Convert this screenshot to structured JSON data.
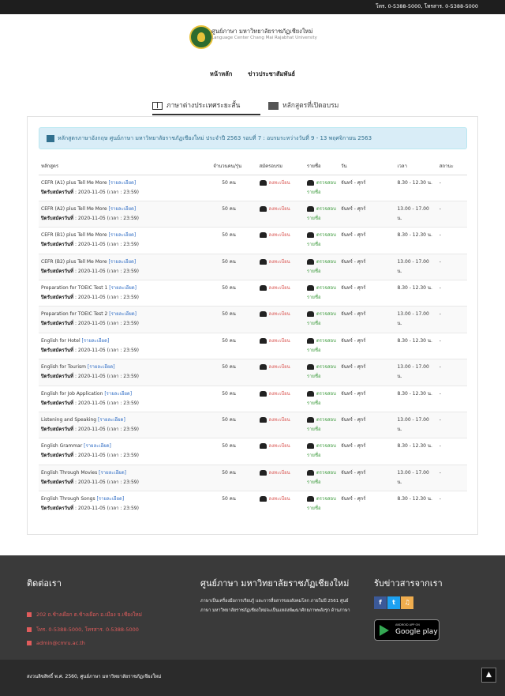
{
  "topbar": {
    "contact": "โทร. 0-5388-5000, โทรสาร. 0-5388-5000"
  },
  "brand": {
    "title_th": "ศูนย์ภาษา มหาวิทยาลัยราชภัฏเชียงใหม่",
    "title_en": "Language Center Chang Mai Rajabhat University"
  },
  "nav": {
    "items": [
      "หน้าหลัก",
      "ข่าวประชาสัมพันธ์"
    ]
  },
  "tabs": [
    {
      "label": "ภาษาต่างประเทศระยะสั้น",
      "icon": "book-icon"
    },
    {
      "label": "หลักสูตรที่เปิดอบรม",
      "icon": "box-icon"
    }
  ],
  "alert": {
    "text": "หลักสูตรภาษาอังกฤษ ศูนย์ภาษา มหาวิทยาลัยราชภัฏเชียงใหม่ ประจำปี 2563 รอบที่ 7 : อบรมระหว่างวันที่ 9 - 13 พฤศจิกายน 2563"
  },
  "table": {
    "headers": [
      "หลักสูตร",
      "จำนวนคน/รุ่น",
      "สมัครอบรม",
      "รายชื่อ",
      "วัน",
      "เวลา",
      "สถานะ"
    ],
    "detail_label": "[รายละเอียด]",
    "deadline_label": "ปิดรับสมัครวันที่",
    "register_label": "ลงทะเบียน",
    "check_label_1": "ตรวจสอบ",
    "check_label_2": "รายชื่อ",
    "rows": [
      {
        "course": "CEFR (A1) plus Tell Me More",
        "deadline": ": 2020-11-05 (เวลา : 23:59)",
        "seats": "50 คน",
        "days": "จันทร์ - ศุกร์",
        "time": "8.30 - 12.30 น.",
        "status": "-"
      },
      {
        "course": "CEFR (A2) plus Tell Me More",
        "deadline": ": 2020-11-05 (เวลา : 23:59)",
        "seats": "50 คน",
        "days": "จันทร์ - ศุกร์",
        "time": "13.00 - 17.00 น.",
        "status": "-"
      },
      {
        "course": "CEFR (B1) plus Tell Me More",
        "deadline": ": 2020-11-05 (เวลา : 23:59)",
        "seats": "50 คน",
        "days": "จันทร์ - ศุกร์",
        "time": "8.30 - 12.30 น.",
        "status": "-"
      },
      {
        "course": "CEFR (B2) plus Tell Me More",
        "deadline": ": 2020-11-05 (เวลา : 23:59)",
        "seats": "50 คน",
        "days": "จันทร์ - ศุกร์",
        "time": "13.00 - 17.00 น.",
        "status": "-"
      },
      {
        "course": "Preparation for TOEIC Test 1",
        "deadline": ": 2020-11-05 (เวลา : 23:59)",
        "seats": "50 คน",
        "days": "จันทร์ - ศุกร์",
        "time": "8.30 - 12.30 น.",
        "status": "-"
      },
      {
        "course": "Preparation for TOEIC Test 2",
        "deadline": ": 2020-11-05 (เวลา : 23:59)",
        "seats": "50 คน",
        "days": "จันทร์ - ศุกร์",
        "time": "13.00 - 17.00 น.",
        "status": "-"
      },
      {
        "course": "English for Hotel",
        "deadline": ": 2020-11-05 (เวลา : 23:59)",
        "seats": "50 คน",
        "days": "จันทร์ - ศุกร์",
        "time": "8.30 - 12.30 น.",
        "status": "-"
      },
      {
        "course": "English for Tourism",
        "deadline": ": 2020-11-05 (เวลา : 23:59)",
        "seats": "50 คน",
        "days": "จันทร์ - ศุกร์",
        "time": "13.00 - 17.00 น.",
        "status": "-"
      },
      {
        "course": "English for Job Application",
        "deadline": ": 2020-11-05 (เวลา : 23:59)",
        "seats": "50 คน",
        "days": "จันทร์ - ศุกร์",
        "time": "8.30 - 12.30 น.",
        "status": "-"
      },
      {
        "course": "Listening and Speaking",
        "deadline": ": 2020-11-05 (เวลา : 23:59)",
        "seats": "50 คน",
        "days": "จันทร์ - ศุกร์",
        "time": "13.00 - 17.00 น.",
        "status": "-"
      },
      {
        "course": "English Grammar",
        "deadline": ": 2020-11-05 (เวลา : 23:59)",
        "seats": "50 คน",
        "days": "จันทร์ - ศุกร์",
        "time": "8.30 - 12.30 น.",
        "status": "-"
      },
      {
        "course": "English Through Movies",
        "deadline": ": 2020-11-05 (เวลา : 23:59)",
        "seats": "50 คน",
        "days": "จันทร์ - ศุกร์",
        "time": "13.00 - 17.00 น.",
        "status": "-"
      },
      {
        "course": "English Through Songs",
        "deadline": ": 2020-11-05 (เวลา : 23:59)",
        "seats": "50 คน",
        "days": "จันทร์ - ศุกร์",
        "time": "8.30 - 12.30 น.",
        "status": "-"
      }
    ]
  },
  "footer": {
    "contact_title": "ติดต่อเรา",
    "address": "202 ถ.ช้างเผือก ต.ช้างเผือก อ.เมือง จ.เชียงใหม่",
    "phone": "โทร. 0-5388-5000, โทรสาร. 0-5388-5000",
    "email": "admin@cmru.ac.th",
    "about_title": "ศูนย์ภาษา มหาวิทยาลัยราชภัฏเชียงใหม่",
    "about_text": "ภาษาเป็นเครื่องมือการเรียนรู้ และการสื่อสารของสังคมโลก ภายในปี 2561 ศูนย์ภาษา มหาวิทยาลัยราชภัฏเชียงใหม่จะเป็นแหล่งพัฒนาศักยภาพพลังรุก ด้านภาษา",
    "news_title": "รับข่าวสารจากเรา",
    "social": [
      {
        "glyph": "f",
        "color": "#3b5998"
      },
      {
        "glyph": "t",
        "color": "#1da1f2"
      },
      {
        "glyph": "♫",
        "color": "#f0ad4e"
      }
    ],
    "gplay_small": "ANDROID APP ON",
    "gplay_big": "Google play",
    "copyright": "สงวนลิขสิทธิ์ พ.ศ. 2560, ศูนย์ภาษา มหาวิทยาลัยราชภัฏเชียงใหม่",
    "totop": "▲"
  }
}
